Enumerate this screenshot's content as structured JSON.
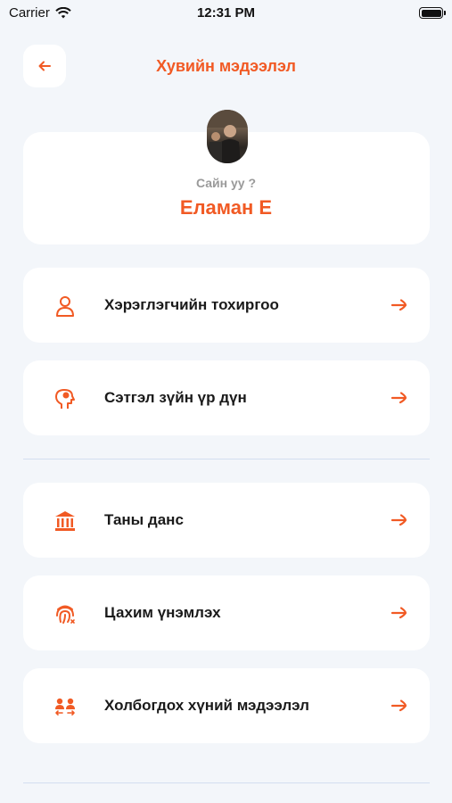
{
  "status_bar": {
    "carrier": "Carrier",
    "time": "12:31 PM"
  },
  "header": {
    "title": "Хувийн мэдээлэл"
  },
  "profile": {
    "greeting": "Сайн уу ?",
    "name": "Еламан Е"
  },
  "menu": {
    "items": [
      {
        "label": "Хэрэглэгчийн тохиргоо",
        "icon": "user-icon"
      },
      {
        "label": "Сэтгэл зүйн үр дүн",
        "icon": "head-brain-icon"
      },
      {
        "label": "Таны данс",
        "icon": "bank-icon"
      },
      {
        "label": "Цахим үнэмлэх",
        "icon": "fingerprint-icon"
      },
      {
        "label": "Холбогдох хүний мэдээлэл",
        "icon": "people-icon"
      }
    ]
  },
  "colors": {
    "accent": "#f15a24",
    "background": "#f3f6fa",
    "card": "#ffffff",
    "divider": "#d3def0"
  }
}
